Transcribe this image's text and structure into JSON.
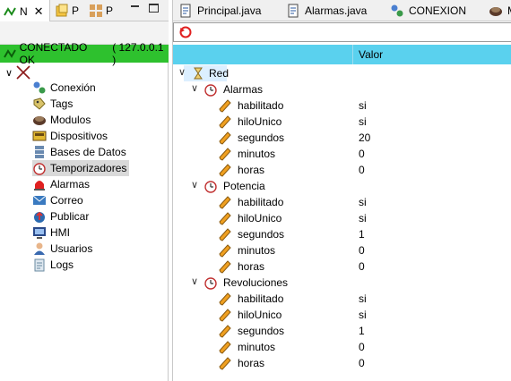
{
  "left_tabs": [
    {
      "label": "N",
      "icon": "navigator-icon"
    },
    {
      "label": "P",
      "icon": "projects-icon"
    },
    {
      "label": "P",
      "icon": "packages-icon"
    }
  ],
  "status": {
    "text": "CONECTADO OK",
    "address": "( 127.0.0.1 )",
    "color": "#2ec12e"
  },
  "nav_items": [
    {
      "label": "Conexión",
      "icon": "connection-icon"
    },
    {
      "label": "Tags",
      "icon": "tag-icon"
    },
    {
      "label": "Modulos",
      "icon": "module-icon"
    },
    {
      "label": "Dispositivos",
      "icon": "device-icon"
    },
    {
      "label": "Bases de Datos",
      "icon": "database-icon"
    },
    {
      "label": "Temporizadores",
      "icon": "timer-icon",
      "selected": true
    },
    {
      "label": "Alarmas",
      "icon": "alarm-icon"
    },
    {
      "label": "Correo",
      "icon": "mail-icon"
    },
    {
      "label": "Publicar",
      "icon": "publish-icon"
    },
    {
      "label": "HMI",
      "icon": "hmi-icon"
    },
    {
      "label": "Usuarios",
      "icon": "users-icon"
    },
    {
      "label": "Logs",
      "icon": "logs-icon"
    }
  ],
  "editor_tabs": [
    {
      "label": "Principal.java",
      "icon": "java-file-icon"
    },
    {
      "label": "Alarmas.java",
      "icon": "java-file-icon"
    },
    {
      "label": "CONEXION",
      "icon": "connection-icon"
    },
    {
      "label": "M",
      "icon": "module-icon"
    }
  ],
  "table": {
    "value_header": "Valor"
  },
  "root": {
    "label": "Red"
  },
  "groups": [
    {
      "name": "Alarmas",
      "props": [
        {
          "key": "habilitado",
          "value": "si"
        },
        {
          "key": "hiloUnico",
          "value": "si"
        },
        {
          "key": "segundos",
          "value": "20"
        },
        {
          "key": "minutos",
          "value": "0"
        },
        {
          "key": "horas",
          "value": "0"
        }
      ]
    },
    {
      "name": "Potencia",
      "props": [
        {
          "key": "habilitado",
          "value": "si"
        },
        {
          "key": "hiloUnico",
          "value": "si"
        },
        {
          "key": "segundos",
          "value": "1"
        },
        {
          "key": "minutos",
          "value": "0"
        },
        {
          "key": "horas",
          "value": "0"
        }
      ]
    },
    {
      "name": "Revoluciones",
      "props": [
        {
          "key": "habilitado",
          "value": "si"
        },
        {
          "key": "hiloUnico",
          "value": "si"
        },
        {
          "key": "segundos",
          "value": "1"
        },
        {
          "key": "minutos",
          "value": "0"
        },
        {
          "key": "horas",
          "value": "0"
        }
      ]
    }
  ]
}
